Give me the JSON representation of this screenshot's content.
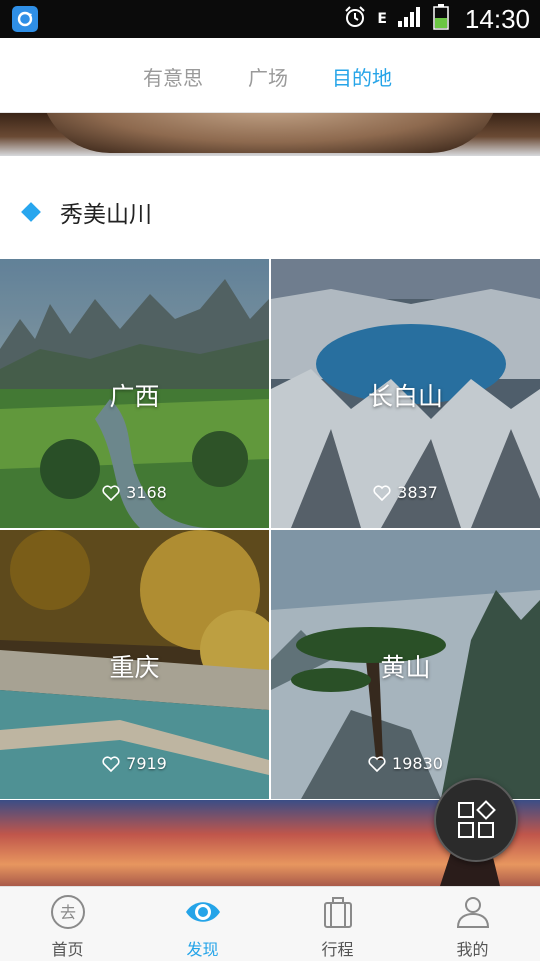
{
  "status_bar": {
    "time": "14:30",
    "network_label": "E"
  },
  "tabs": [
    {
      "label": "有意思",
      "active": false
    },
    {
      "label": "广场",
      "active": false
    },
    {
      "label": "目的地",
      "active": true
    }
  ],
  "section": {
    "title": "秀美山川"
  },
  "destinations": [
    {
      "name": "广西",
      "likes": "3168"
    },
    {
      "name": "长白山",
      "likes": "3837"
    },
    {
      "name": "重庆",
      "likes": "7919"
    },
    {
      "name": "黄山",
      "likes": "19830"
    }
  ],
  "bottom_nav": [
    {
      "label": "首页",
      "icon": "home-go-icon",
      "active": false
    },
    {
      "label": "发现",
      "icon": "eye-icon",
      "active": true
    },
    {
      "label": "行程",
      "icon": "luggage-icon",
      "active": false
    },
    {
      "label": "我的",
      "icon": "user-icon",
      "active": false
    }
  ],
  "fab": {
    "icon": "grid-apps-icon"
  },
  "colors": {
    "accent": "#25a4e8",
    "status_bar": "#0b0b0b",
    "fab": "#2b2b2b"
  }
}
